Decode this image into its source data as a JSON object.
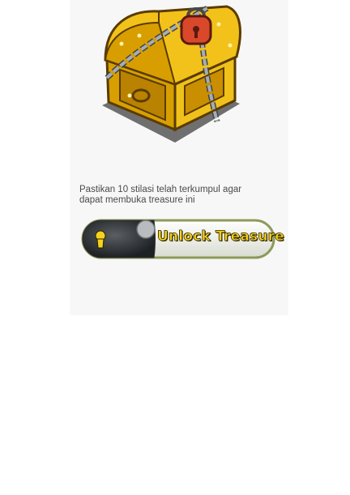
{
  "treasure": {
    "image_icon": "treasure-chest-locked-icon",
    "instruction_text": "Pastikan 10 stilasi telah terkumpul agar dapat membuka treasure ini",
    "unlock_button_label": "Unlock Treasure",
    "unlock_button_icon": "keyhole-icon",
    "colors": {
      "panel_background": "#f7f7f7",
      "label_yellow": "#f4d21f",
      "gold": "#e8b315",
      "chain": "#8a8f95",
      "padlock": "#d9482b"
    }
  }
}
